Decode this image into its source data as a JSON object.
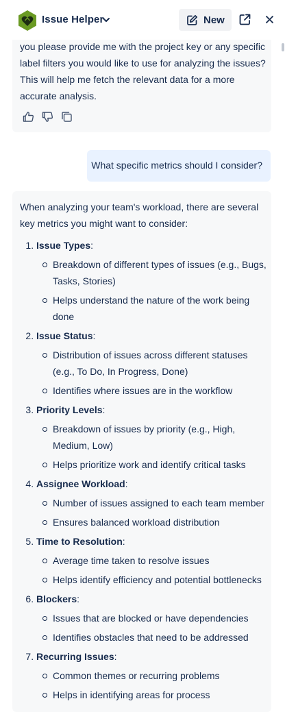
{
  "header": {
    "title": "Issue Helper",
    "new_label": "New",
    "icons": [
      "logo-icon",
      "chevron-down-icon",
      "pencil-square-icon",
      "external-link-icon",
      "close-icon"
    ],
    "accent": "#6a9a23"
  },
  "messages": [
    {
      "role": "assistant",
      "text": "you please provide me with the project key or any specific label filters you would like to use for analyzing the issues? This will help me fetch the relevant data for a more accurate analysis.",
      "feedback_icons": [
        "thumbs-up-icon",
        "thumbs-down-icon",
        "copy-icon"
      ]
    },
    {
      "role": "user",
      "text": "What specific metrics should I consider?"
    },
    {
      "role": "assistant",
      "intro": "When analyzing your team's workload, there are several key metrics you might want to consider:",
      "metrics": [
        {
          "title": "Issue Types",
          "details": [
            "Breakdown of different types of issues (e.g., Bugs, Tasks, Stories)",
            "Helps understand the nature of the work being done"
          ]
        },
        {
          "title": "Issue Status",
          "details": [
            "Distribution of issues across different statuses (e.g., To Do, In Progress, Done)",
            "Identifies where issues are in the workflow"
          ]
        },
        {
          "title": "Priority Levels",
          "details": [
            "Breakdown of issues by priority (e.g., High, Medium, Low)",
            "Helps prioritize work and identify critical tasks"
          ]
        },
        {
          "title": "Assignee Workload",
          "details": [
            "Number of issues assigned to each team member",
            "Ensures balanced workload distribution"
          ]
        },
        {
          "title": "Time to Resolution",
          "details": [
            "Average time taken to resolve issues",
            "Helps identify efficiency and potential bottlenecks"
          ]
        },
        {
          "title": "Blockers",
          "details": [
            "Issues that are blocked or have dependencies",
            "Identifies obstacles that need to be addressed"
          ]
        },
        {
          "title": "Recurring Issues",
          "details": [
            "Common themes or recurring problems",
            "Helps in identifying areas for process"
          ]
        }
      ]
    }
  ]
}
